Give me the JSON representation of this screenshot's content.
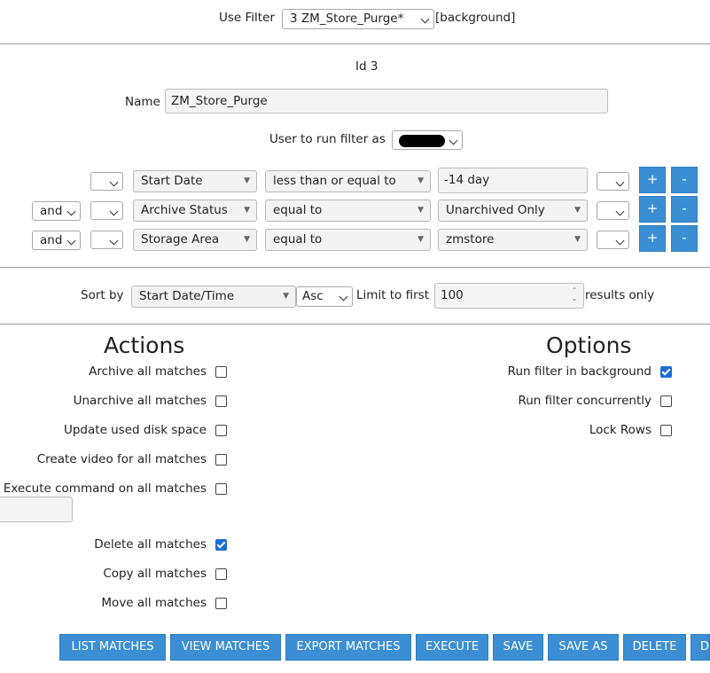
{
  "filter_bar": {
    "label": "Use Filter",
    "selected": "3 ZM_Store_Purge*",
    "background_tag": "[background]"
  },
  "id_text": "Id 3",
  "name": {
    "label": "Name",
    "value": "ZM_Store_Purge"
  },
  "user": {
    "label": "User to run filter as",
    "selected": ""
  },
  "terms": [
    {
      "conj": "",
      "bracket": "",
      "attr": "Start Date",
      "op": "less than or equal to",
      "val": "-14 day",
      "close": ""
    },
    {
      "conj": "and",
      "bracket": "",
      "attr": "Archive Status",
      "op": "equal to",
      "val": "Unarchived Only",
      "close": ""
    },
    {
      "conj": "and",
      "bracket": "",
      "attr": "Storage Area",
      "op": "equal to",
      "val": "zmstore",
      "close": ""
    }
  ],
  "plus_label": "+",
  "minus_label": "-",
  "sort": {
    "label": "Sort by",
    "field": "Start Date/Time",
    "dir": "Asc",
    "limit_label": "Limit to first",
    "limit": "100",
    "suffix": "results only"
  },
  "actions": {
    "heading": "Actions",
    "items": [
      {
        "label": "Archive all matches",
        "checked": false
      },
      {
        "label": "Unarchive all matches",
        "checked": false
      },
      {
        "label": "Update used disk space",
        "checked": false
      },
      {
        "label": "Create video for all matches",
        "checked": false
      },
      {
        "label": "Execute command on all matches",
        "checked": false
      },
      {
        "label": "Delete all matches",
        "checked": true
      },
      {
        "label": "Copy all matches",
        "checked": false
      },
      {
        "label": "Move all matches",
        "checked": false
      }
    ]
  },
  "options": {
    "heading": "Options",
    "items": [
      {
        "label": "Run filter in background",
        "checked": true
      },
      {
        "label": "Run filter concurrently",
        "checked": false
      },
      {
        "label": "Lock Rows",
        "checked": false
      }
    ]
  },
  "buttons": [
    "LIST MATCHES",
    "VIEW MATCHES",
    "EXPORT MATCHES",
    "EXECUTE",
    "SAVE",
    "SAVE AS",
    "DELETE",
    "DE"
  ],
  "accent_color": "#3b8ed3",
  "checkbox_checked_color": "#1e6ed2"
}
